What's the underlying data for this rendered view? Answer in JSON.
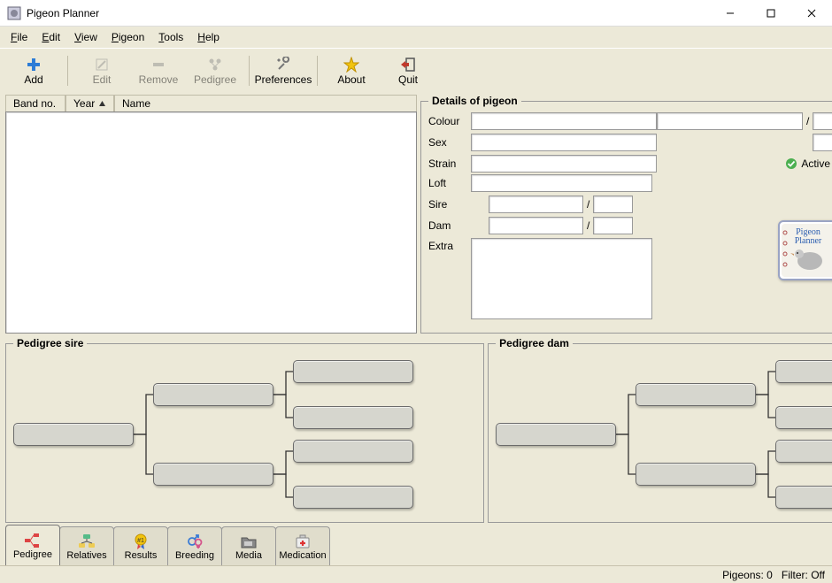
{
  "app": {
    "title": "Pigeon Planner"
  },
  "menu": {
    "file": "File",
    "edit": "Edit",
    "view": "View",
    "pigeon": "Pigeon",
    "tools": "Tools",
    "help": "Help"
  },
  "toolbar": {
    "add": "Add",
    "edit": "Edit",
    "remove": "Remove",
    "pedigree": "Pedigree",
    "preferences": "Preferences",
    "about": "About",
    "quit": "Quit"
  },
  "list": {
    "col_band": "Band no.",
    "col_year": "Year",
    "col_name": "Name"
  },
  "details": {
    "legend": "Details of pigeon",
    "colour": "Colour",
    "sex": "Sex",
    "strain": "Strain",
    "loft": "Loft",
    "sire": "Sire",
    "dam": "Dam",
    "extra": "Extra",
    "slash": "/",
    "active": "Active",
    "logo_line1": "Pigeon",
    "logo_line2": "Planner"
  },
  "pedigree": {
    "sire_legend": "Pedigree sire",
    "dam_legend": "Pedigree dam"
  },
  "tabs": {
    "pedigree": "Pedigree",
    "relatives": "Relatives",
    "results": "Results",
    "breeding": "Breeding",
    "media": "Media",
    "medication": "Medication"
  },
  "status": {
    "pigeons_label": "Pigeons:",
    "pigeons_count": "0",
    "filter_label": "Filter:",
    "filter_value": "Off"
  }
}
